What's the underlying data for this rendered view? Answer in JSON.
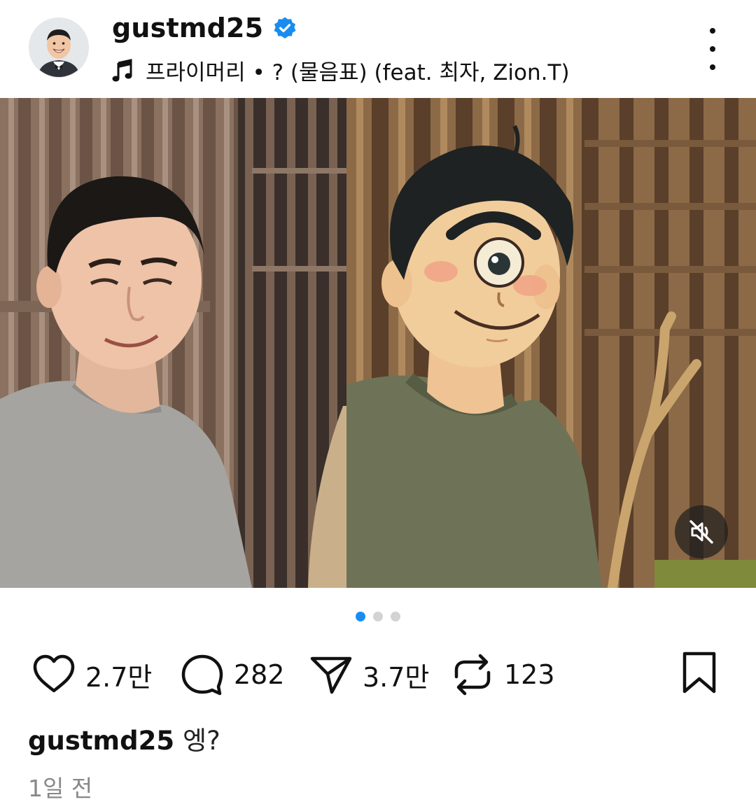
{
  "post": {
    "username": "gustmd25",
    "verified": true,
    "music": "프라이머리 • ? (물음표) (feat. 최자, Zion.T)",
    "carousel": {
      "current": 1,
      "total": 3
    },
    "actions": {
      "likes": "2.7만",
      "comments": "282",
      "shares": "3.7만",
      "reposts": "123"
    },
    "caption": {
      "username": "gustmd25",
      "text": "엥?"
    },
    "timestamp": "1일 전"
  },
  "icons": {
    "verified": "verified-badge-icon",
    "music": "music-note-icon",
    "more": "more-vertical-icon",
    "mute": "speaker-muted-icon",
    "like": "heart-icon",
    "comment": "comment-bubble-icon",
    "share": "paper-plane-icon",
    "repost": "repost-icon",
    "save": "bookmark-icon"
  },
  "colors": {
    "verified": "#1a8cf0",
    "active_dot": "#1a8cf0",
    "inactive_dot": "#d3d3d3",
    "timestamp": "#888888"
  }
}
